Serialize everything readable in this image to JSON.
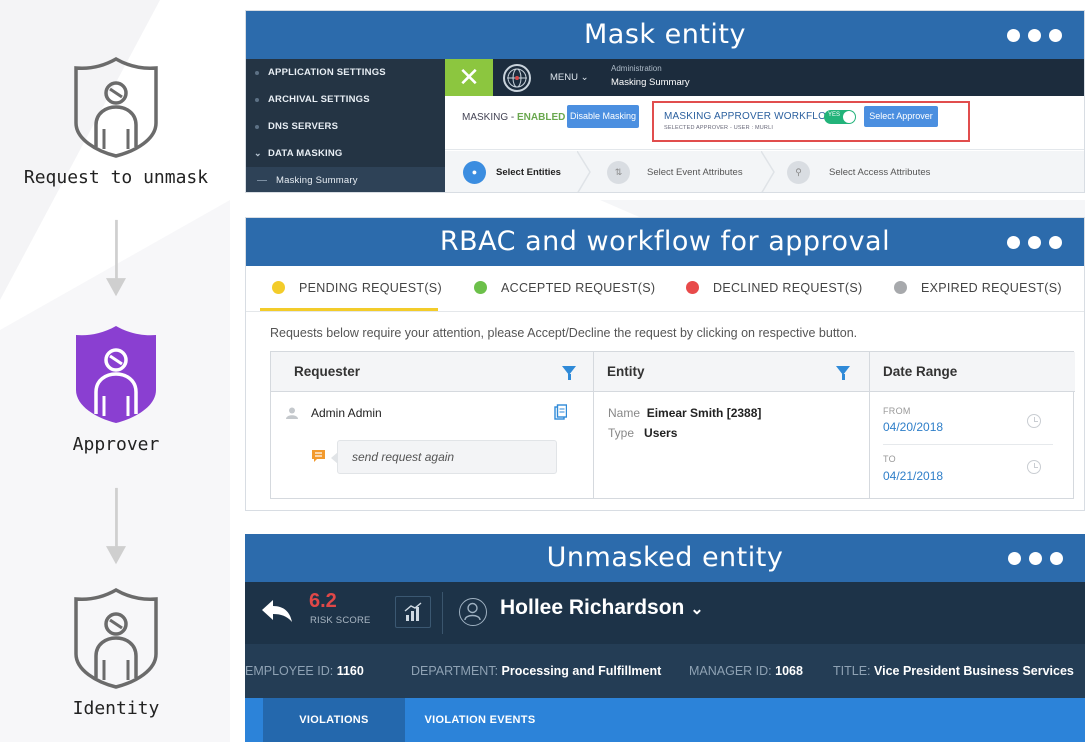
{
  "flow": {
    "nodes": [
      {
        "label": "Request to unmask",
        "icon": "shield-user-icon"
      },
      {
        "label": "Approver",
        "icon": "shield-user-icon"
      },
      {
        "label": "Identity",
        "icon": "shield-user-icon"
      }
    ],
    "colors": {
      "outline": "#6b6b6b",
      "approver": "#8a3fd1",
      "arrow": "#cfcfcf"
    }
  },
  "mask_panel": {
    "title": "Mask entity",
    "sidebar": {
      "items": [
        "APPLICATION SETTINGS",
        "ARCHIVAL SETTINGS",
        "DNS SERVERS",
        "DATA MASKING"
      ],
      "sub_item": "Masking Summary"
    },
    "topbar": {
      "menu_label": "MENU",
      "breadcrumb_parent": "Administration",
      "breadcrumb_current": "Masking Summary"
    },
    "masking_label": "MASKING - ",
    "masking_status": "ENABLED",
    "disable_button": "Disable Masking",
    "workflow_title": "MASKING APPROVER WORKFLOW",
    "workflow_toggle": "YES",
    "workflow_subtitle": "SELECTED APPROVER - USER : MURLI",
    "select_approver_button": "Select Approver",
    "steps": [
      "Select Entities",
      "Select Event Attributes",
      "Select Access Attributes"
    ]
  },
  "rbac_panel": {
    "title": "RBAC and workflow for approval",
    "tabs": [
      {
        "label": "PENDING REQUEST(S)",
        "color": "#f3cc2a"
      },
      {
        "label": "ACCEPTED REQUEST(S)",
        "color": "#6cc04a"
      },
      {
        "label": "DECLINED REQUEST(S)",
        "color": "#e84a4a"
      },
      {
        "label": "EXPIRED REQUEST(S)",
        "color": "#a7a9ac"
      }
    ],
    "notice": "Requests below require your attention, please Accept/Decline the request by clicking on respective button.",
    "columns": [
      "Requester",
      "Entity",
      "Date Range"
    ],
    "row": {
      "requester": "Admin Admin",
      "comment": "send request again",
      "entity_name_label": "Name",
      "entity_name": "Eimear Smith [2388]",
      "entity_type_label": "Type",
      "entity_type": "Users",
      "from_label": "FROM",
      "from_date": "04/20/2018",
      "to_label": "TO",
      "to_date": "04/21/2018"
    }
  },
  "unmask_panel": {
    "title": "Unmasked entity",
    "risk_score": "6.2",
    "risk_label": "RISK SCORE",
    "name": "Hollee Richardson",
    "info": [
      {
        "label": "EMPLOYEE ID:",
        "value": "1160"
      },
      {
        "label": "DEPARTMENT:",
        "value": "Processing and Fulfillment"
      },
      {
        "label": "MANAGER ID:",
        "value": "1068"
      },
      {
        "label": "TITLE:",
        "value": "Vice President Business Services"
      }
    ],
    "tabs": [
      "VIOLATIONS",
      "VIOLATION EVENTS"
    ]
  }
}
